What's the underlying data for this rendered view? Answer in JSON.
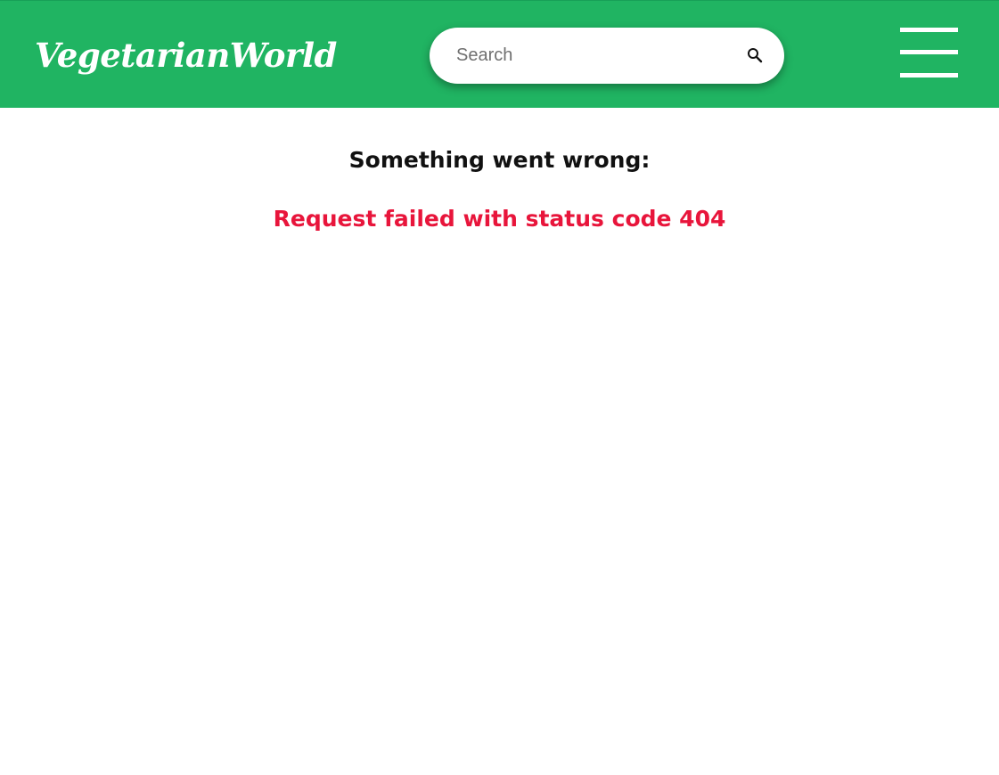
{
  "header": {
    "logo_text": "VegetarianWorld",
    "background_color": "#20b462",
    "search": {
      "placeholder": "Search",
      "value": "",
      "icon": "search-icon"
    },
    "menu_icon": "hamburger-menu-icon"
  },
  "main": {
    "error_title": "Something went wrong:",
    "error_message": "Request failed with status code 404",
    "error_color": "#e8153b"
  }
}
